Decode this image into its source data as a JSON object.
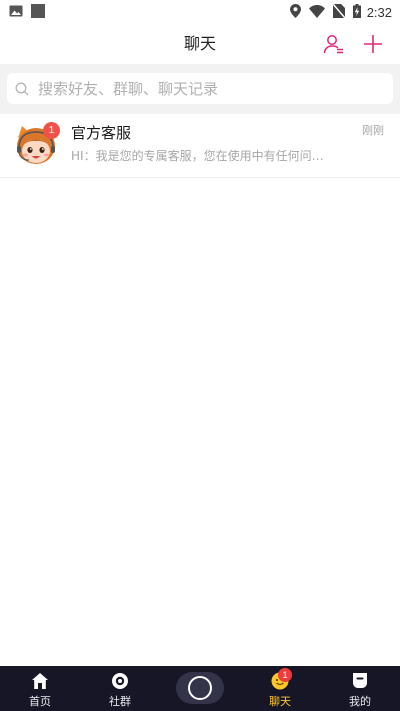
{
  "status_bar": {
    "time": "2:32",
    "icons": [
      "image-icon",
      "square-icon",
      "location-icon",
      "wifi-icon",
      "no-sim-icon",
      "battery-charging-icon"
    ]
  },
  "header": {
    "title": "聊天",
    "contacts_icon": "contacts-icon",
    "add_icon": "plus-icon",
    "accent_color": "#e0287a"
  },
  "search": {
    "placeholder": "搜索好友、群聊、聊天记录",
    "value": ""
  },
  "chats": [
    {
      "name": "官方客服",
      "preview": "HI：我是您的专属客服，您在使用中有任何问…",
      "time": "刚刚",
      "unread": "1",
      "avatar": "customer-service-avatar"
    }
  ],
  "tabs": [
    {
      "label": "首页",
      "icon": "home-icon",
      "active": false
    },
    {
      "label": "社群",
      "icon": "community-icon",
      "active": false
    },
    {
      "label": "",
      "icon": "camera-icon",
      "active": false
    },
    {
      "label": "聊天",
      "icon": "chat-icon",
      "active": true,
      "badge": "1"
    },
    {
      "label": "我的",
      "icon": "profile-icon",
      "active": false
    }
  ],
  "colors": {
    "tab_bar_bg": "#161627",
    "active_tab": "#ffc72c",
    "badge_red": "#f0524a"
  }
}
